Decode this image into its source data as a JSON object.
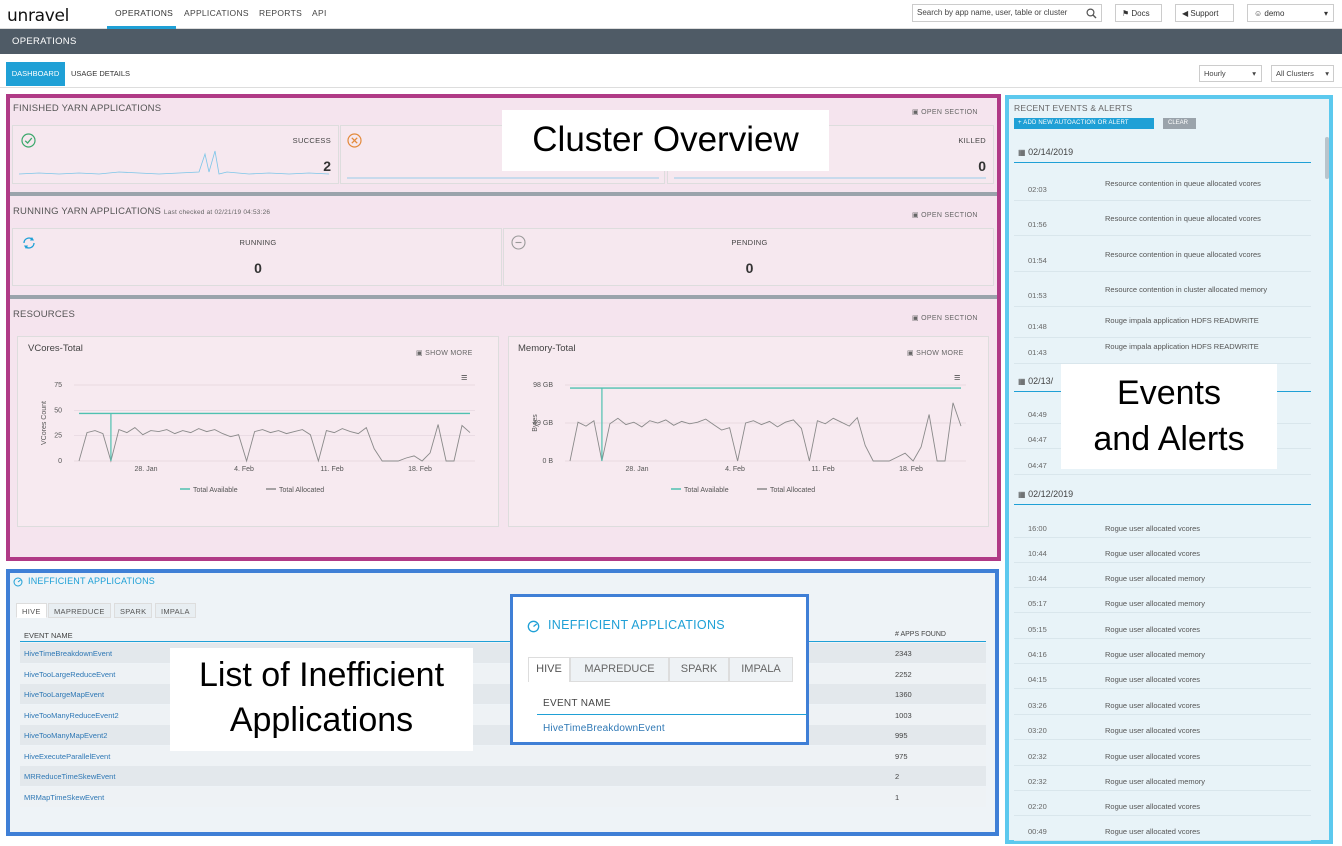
{
  "app": {
    "logo": "unravel"
  },
  "nav": {
    "tabs": [
      {
        "label": "OPERATIONS"
      },
      {
        "label": "APPLICATIONS"
      },
      {
        "label": "REPORTS"
      },
      {
        "label": "API"
      }
    ],
    "search_placeholder": "Search by app name, user, table or cluster",
    "docs": "Docs",
    "support": "Support",
    "user": "demo"
  },
  "header": {
    "title": "OPERATIONS"
  },
  "subnav": {
    "dashboard": "DASHBOARD",
    "usage": "USAGE DETAILS",
    "interval": "Hourly",
    "cluster": "All Clusters"
  },
  "finished": {
    "title": "FINISHED YARN APPLICATIONS",
    "open": "OPEN SECTION",
    "success_label": "SUCCESS",
    "success_value": "2",
    "killed_label": "KILLED",
    "killed_value": "0"
  },
  "running": {
    "title": "RUNNING YARN APPLICATIONS",
    "checked": "Last checked at 02/21/19 04:53:26",
    "open": "OPEN SECTION",
    "running_label": "RUNNING",
    "running_value": "0",
    "pending_label": "PENDING",
    "pending_value": "0"
  },
  "resources": {
    "title": "RESOURCES",
    "open": "OPEN SECTION"
  },
  "chart_data": [
    {
      "type": "line",
      "title": "VCores-Total",
      "ylabel": "VCores Count",
      "show_more": "SHOW MORE",
      "y_ticks": [
        "75",
        "50",
        "25",
        "0"
      ],
      "ylim": [
        0,
        75
      ],
      "x_ticks": [
        "28. Jan",
        "4. Feb",
        "11. Feb",
        "18. Feb"
      ],
      "legend": [
        "Total Available",
        "Total Allocated"
      ],
      "series": [
        {
          "name": "Total Available",
          "color": "#4fc1b0",
          "values": [
            47,
            47,
            47,
            47,
            47,
            47,
            47,
            47,
            47,
            47,
            47,
            47,
            47,
            47,
            47,
            47,
            47,
            47,
            47,
            47,
            47,
            47,
            47,
            47,
            47,
            47,
            47,
            47,
            47,
            47,
            47,
            47,
            47,
            47,
            47,
            47,
            47,
            47,
            47,
            47,
            47,
            47,
            47,
            47,
            47,
            47,
            47,
            47,
            47,
            47
          ]
        },
        {
          "name": "Total Allocated",
          "color": "#8a8a8a",
          "values": [
            0,
            28,
            30,
            27,
            0,
            31,
            28,
            33,
            26,
            30,
            29,
            31,
            27,
            30,
            28,
            32,
            29,
            31,
            27,
            24,
            26,
            0,
            29,
            31,
            28,
            30,
            27,
            29,
            31,
            26,
            0,
            30,
            28,
            32,
            29,
            27,
            33,
            12,
            0,
            0,
            0,
            3,
            5,
            0,
            8,
            36,
            0,
            0,
            35,
            28
          ]
        }
      ]
    },
    {
      "type": "line",
      "title": "Memory-Total",
      "ylabel": "Bytes",
      "show_more": "SHOW MORE",
      "y_ticks": [
        "98 GB",
        "49 GB",
        "0 B"
      ],
      "ylim": [
        0,
        98
      ],
      "x_ticks": [
        "28. Jan",
        "4. Feb",
        "11. Feb",
        "18. Feb"
      ],
      "legend": [
        "Total Available",
        "Total Allocated"
      ],
      "series": [
        {
          "name": "Total Available",
          "color": "#4fc1b0",
          "values": [
            94,
            94,
            94,
            94,
            94,
            94,
            94,
            94,
            94,
            94,
            94,
            94,
            94,
            94,
            94,
            94,
            94,
            94,
            94,
            94,
            94,
            94,
            94,
            94,
            94,
            94,
            94,
            94,
            94,
            94,
            94,
            94,
            94,
            94,
            94,
            94,
            94,
            94,
            94,
            94,
            94,
            94,
            94,
            94,
            94,
            94,
            94,
            94,
            94,
            94
          ]
        },
        {
          "name": "Total Allocated",
          "color": "#8a8a8a",
          "values": [
            0,
            50,
            45,
            52,
            0,
            48,
            55,
            47,
            50,
            44,
            52,
            49,
            53,
            46,
            51,
            48,
            50,
            54,
            47,
            40,
            43,
            0,
            49,
            52,
            47,
            51,
            44,
            50,
            53,
            42,
            0,
            52,
            48,
            55,
            50,
            45,
            56,
            20,
            0,
            0,
            0,
            5,
            10,
            0,
            18,
            60,
            0,
            0,
            75,
            45
          ]
        }
      ]
    }
  ],
  "events": {
    "title": "RECENT EVENTS & ALERTS",
    "add_label": "+ ADD NEW AUTOACTION OR ALERT",
    "clear_label": "CLEAR",
    "groups": [
      {
        "date": "02/14/2019",
        "items": [
          {
            "time": "02:03",
            "text": "Resource contention in queue allocated vcores"
          },
          {
            "time": "01:56",
            "text": "Resource contention in queue allocated vcores"
          },
          {
            "time": "01:54",
            "text": "Resource contention in queue allocated vcores"
          },
          {
            "time": "01:53",
            "text": "Resource contention in cluster allocated memory"
          },
          {
            "time": "01:48",
            "text": "Rouge impala application HDFS READWRITE"
          },
          {
            "time": "01:43",
            "text": "Rouge impala application HDFS READWRITE"
          }
        ]
      },
      {
        "date": "02/13/",
        "items": [
          {
            "time": "04:49",
            "text": ""
          },
          {
            "time": "04:47",
            "text": ""
          },
          {
            "time": "04:47",
            "text": ""
          }
        ]
      },
      {
        "date": "02/12/2019",
        "items": [
          {
            "time": "16:00",
            "text": "Rogue user allocated vcores"
          },
          {
            "time": "10:44",
            "text": "Rogue user allocated vcores"
          },
          {
            "time": "10:44",
            "text": "Rogue user allocated memory"
          },
          {
            "time": "05:17",
            "text": "Rogue user allocated memory"
          },
          {
            "time": "05:15",
            "text": "Rogue user allocated vcores"
          },
          {
            "time": "04:16",
            "text": "Rogue user allocated memory"
          },
          {
            "time": "04:15",
            "text": "Rogue user allocated vcores"
          },
          {
            "time": "03:26",
            "text": "Rogue user allocated vcores"
          },
          {
            "time": "03:20",
            "text": "Rogue user allocated vcores"
          },
          {
            "time": "02:32",
            "text": "Rogue user allocated vcores"
          },
          {
            "time": "02:32",
            "text": "Rogue user allocated memory"
          },
          {
            "time": "02:20",
            "text": "Rogue user allocated vcores"
          },
          {
            "time": "00:49",
            "text": "Rogue user allocated vcores"
          }
        ]
      }
    ]
  },
  "inefficient": {
    "title": "INEFFICIENT APPLICATIONS",
    "tabs": [
      "HIVE",
      "MAPREDUCE",
      "SPARK",
      "IMPALA"
    ],
    "col_event": "EVENT NAME",
    "col_count": "# APPS FOUND",
    "rows": [
      {
        "name": "HiveTimeBreakdownEvent",
        "count": "2343"
      },
      {
        "name": "HiveTooLargeReduceEvent",
        "count": "2252"
      },
      {
        "name": "HiveTooLargeMapEvent",
        "count": "1360"
      },
      {
        "name": "HiveTooManyReduceEvent2",
        "count": "1003"
      },
      {
        "name": "HiveTooManyMapEvent2",
        "count": "995"
      },
      {
        "name": "HiveExecuteParallelEvent",
        "count": "975"
      },
      {
        "name": "MRReduceTimeSkewEvent",
        "count": "2"
      },
      {
        "name": "MRMapTimeSkewEvent",
        "count": "1"
      }
    ]
  },
  "callouts": {
    "cluster": "Cluster Overview",
    "events_l1": "Events",
    "events_l2": "and Alerts",
    "list_l1": "List of Inefficient",
    "list_l2": "Applications"
  },
  "zoom": {
    "title": "INEFFICIENT APPLICATIONS",
    "tabs": [
      "HIVE",
      "MAPREDUCE",
      "SPARK",
      "IMPALA"
    ],
    "col_event": "EVENT NAME",
    "first_row": "HiveTimeBreakdownEvent"
  }
}
